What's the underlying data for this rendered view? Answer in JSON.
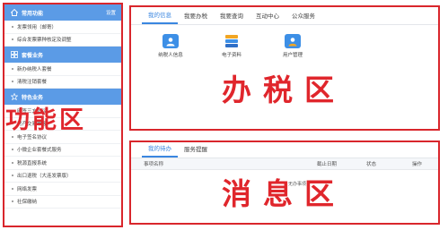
{
  "left_panel": {
    "sections": [
      {
        "title": "常用功能",
        "settings_label": "设置",
        "items": [
          "发票领用（邮寄）",
          "综合发票票种核定及调整"
        ]
      },
      {
        "title": "套餐业务",
        "items": [
          "新办纳税人套餐",
          "清税注销套餐"
        ]
      },
      {
        "title": "特色业务",
        "items": [
          "网签三方协议",
          "房产交易申报",
          "电子签名协议",
          "小微企业套餐式服务",
          "税源直报系统",
          "出口退税（大连发票版）",
          "网络发票",
          "社保缴纳"
        ]
      }
    ],
    "overlay_label": "功能区"
  },
  "tax_panel": {
    "tabs": [
      "我的信息",
      "我要办税",
      "我要查询",
      "互动中心",
      "公众服务"
    ],
    "active_tab": 0,
    "shortcuts": [
      {
        "label": "纳税人信息",
        "icon": "taxpayer-card-icon"
      },
      {
        "label": "电子资料",
        "icon": "documents-icon"
      },
      {
        "label": "用户管理",
        "icon": "user-manage-icon"
      }
    ],
    "overlay_label": "办税区"
  },
  "message_panel": {
    "tabs": [
      "我的待办",
      "服务提醒"
    ],
    "active_tab": 0,
    "columns": [
      "事项名称",
      "截止日期",
      "状态",
      "操作"
    ],
    "empty_text": "无办事项",
    "overlay_label": "消息区"
  },
  "colors": {
    "accent_red": "#d9262c",
    "header_blue": "#5b9be6",
    "tab_blue": "#3a86e0"
  }
}
